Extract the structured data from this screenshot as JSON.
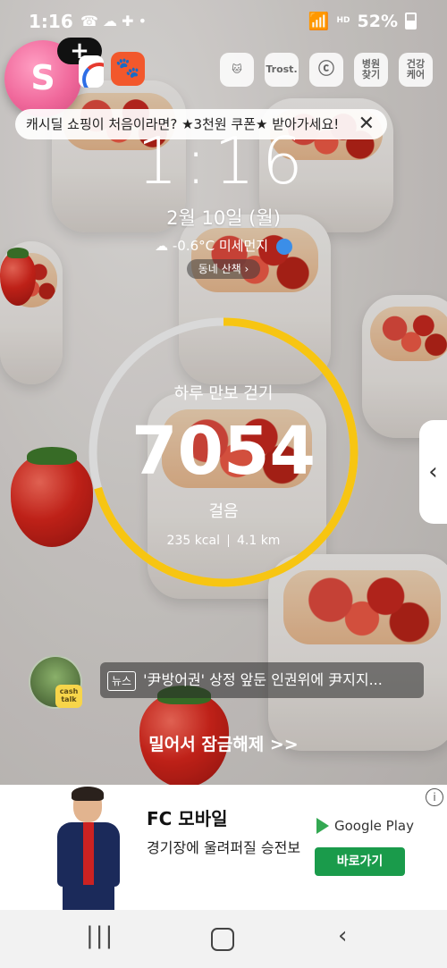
{
  "status_bar": {
    "time": "1:16",
    "icons_left": "☎ ☁ ✚ •",
    "hd": "HD",
    "battery": "52%"
  },
  "shortcuts": {
    "bubble_letter": "S",
    "plus": "+",
    "right_labels": [
      "Trost.",
      "병원\n찾기",
      "건강\n케어"
    ]
  },
  "top_ad": {
    "text": "캐시딜 쇼핑이 처음이라면? ★3천원 쿠폰★ 받아가세요!",
    "close": "✕"
  },
  "lock": {
    "clock": "1:16",
    "date": "2월 10일 (월)",
    "weather": "-0.6°C 미세먼지",
    "walk_button": "동네 산책 ›"
  },
  "steps": {
    "label": "하루 만보 걷기",
    "count": "7054",
    "unit": "걸음",
    "kcal": "235 kcal",
    "distance": "4.1 km",
    "progress_fraction": 0.7054,
    "ring_color": "#f7c512",
    "track_color": "#d9d9d9"
  },
  "side_handle": {
    "arrow": "‹"
  },
  "news": {
    "avatar_badge": "cash\ntalk",
    "badge": "뉴스",
    "headline": "'尹방어권' 상정 앞둔 인권위에 尹지지..."
  },
  "unlock_hint": "밀어서 잠금해제 >>",
  "bottom_ad": {
    "info": "i",
    "title": "FC 모바일",
    "subtitle": "경기장에 울려퍼질 승전보",
    "store": "Google Play",
    "cta": "바로가기"
  },
  "nav": {
    "recent": "|||",
    "back": "‹"
  }
}
